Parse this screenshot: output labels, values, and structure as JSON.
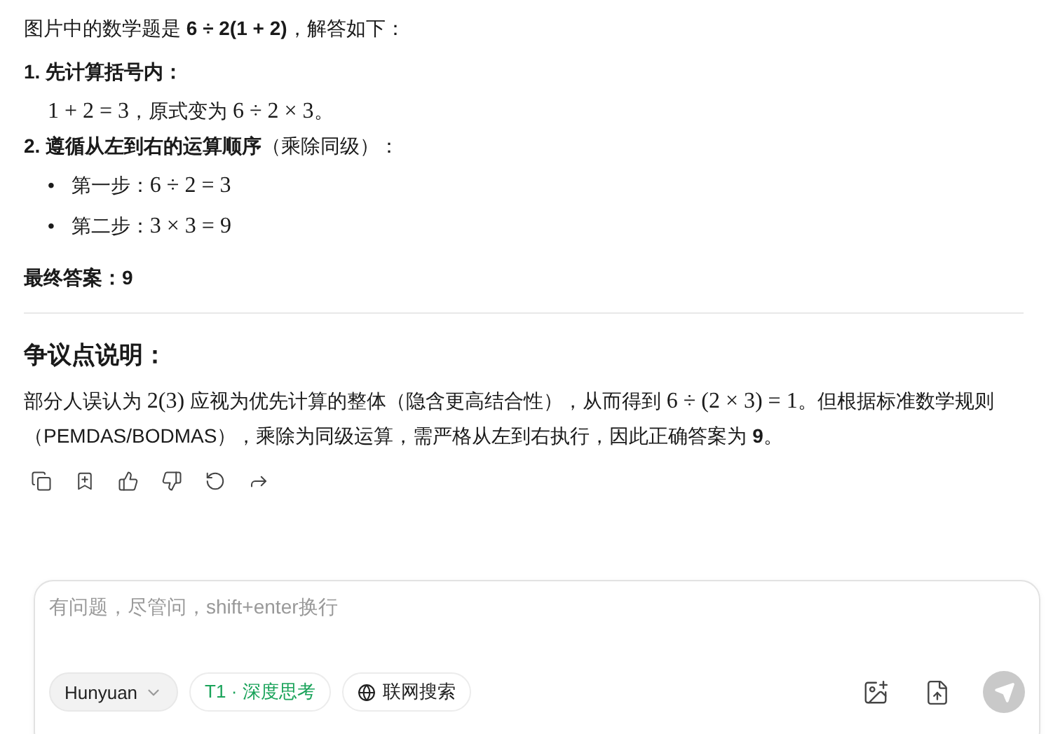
{
  "answer": {
    "intro": [
      {
        "kind": "text",
        "text": "图片中的数学题是 "
      },
      {
        "kind": "bold",
        "text": "6 ÷ 2(1 + 2)"
      },
      {
        "kind": "text",
        "text": "，解答如下："
      }
    ],
    "steps": [
      {
        "title": "1. 先计算括号内：",
        "lines": [
          [
            {
              "kind": "math",
              "text": "1 + 2 = 3"
            },
            {
              "kind": "text",
              "text": "，原式变为 "
            },
            {
              "kind": "math",
              "text": "6 ÷ 2 × 3"
            },
            {
              "kind": "text",
              "text": "。"
            }
          ]
        ]
      },
      {
        "title": "2. 遵循从左到右的运算顺序",
        "title_note": "（乘除同级）：",
        "bullets": [
          {
            "marker": "•",
            "segments": [
              {
                "kind": "text",
                "text": "第一步："
              },
              {
                "kind": "math",
                "text": "6 ÷ 2 = 3"
              }
            ]
          },
          {
            "marker": "•",
            "segments": [
              {
                "kind": "text",
                "text": "第二步："
              },
              {
                "kind": "math",
                "text": "3 × 3 = 9"
              }
            ]
          }
        ]
      }
    ],
    "final": "最终答案：9",
    "heading": "争议点说明：",
    "paragraph": [
      {
        "kind": "text",
        "text": "部分人误认为 "
      },
      {
        "kind": "math",
        "text": "2(3)"
      },
      {
        "kind": "text",
        "text": " 应视为优先计算的整体（隐含更高结合性），从而得到 "
      },
      {
        "kind": "math",
        "text": "6 ÷ (2 × 3) = 1"
      },
      {
        "kind": "text",
        "text": "。但根据标准数学规则（PEMDAS/BODMAS），乘除为同级运算，需严格从左到右执行，因此正确答案为 "
      },
      {
        "kind": "bold",
        "text": "9"
      },
      {
        "kind": "text",
        "text": "。"
      }
    ]
  },
  "composer": {
    "placeholder": "有问题，尽管问，shift+enter换行",
    "model": "Hunyuan",
    "toggles": [
      {
        "label": "T1 · 深度思考",
        "selected": true,
        "kind": "plain"
      },
      {
        "label": "联网搜索",
        "selected": false,
        "kind": "globe"
      }
    ],
    "send_disabled": true
  }
}
